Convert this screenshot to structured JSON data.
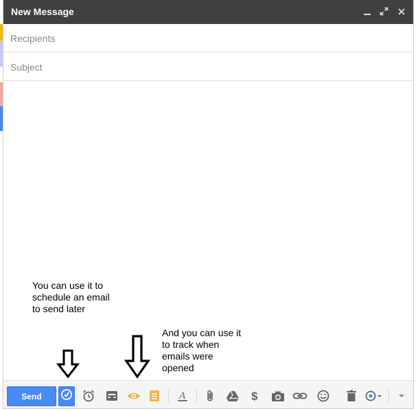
{
  "window": {
    "title": "New Message",
    "controls": [
      "minimize-icon",
      "expand-icon",
      "close-icon"
    ]
  },
  "fields": {
    "recipients_placeholder": "Recipients",
    "subject_placeholder": "Subject"
  },
  "annotations": {
    "schedule_note": "You can use it to\nschedule an email\nto send later",
    "track_note": "And you can use it\nto track when\nemails were\nopened"
  },
  "toolbar": {
    "send_label": "Send",
    "icons": [
      "schedule-clock-icon",
      "alarm-clock-icon",
      "inbox-template-icon",
      "eye-tracking-icon",
      "notes-icon",
      "text-format-icon",
      "attachment-icon",
      "drive-icon",
      "dollar-icon",
      "camera-icon",
      "link-icon",
      "emoji-icon",
      "trash-icon",
      "signature-icon",
      "more-options-icon"
    ]
  },
  "colors": {
    "titlebar": "#404040",
    "send_button": "#4a8af4",
    "tracking_orange": "#f3b348",
    "toolbar_icon": "#666666",
    "edge_strip": [
      "#f4b400",
      "#c7c7ff",
      "#ffffff",
      "#f2a9a0",
      "#4a86e8"
    ]
  }
}
